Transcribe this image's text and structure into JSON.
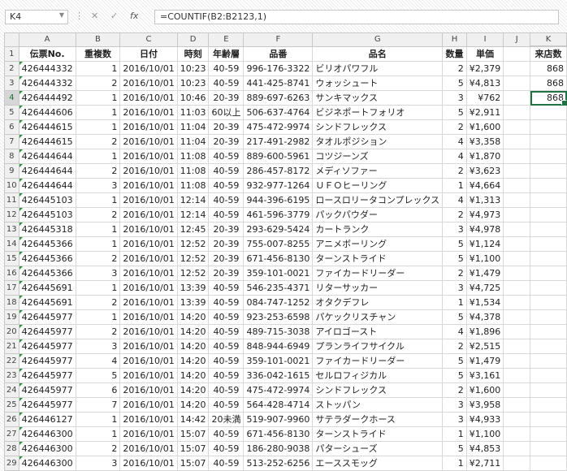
{
  "formula_bar": {
    "name_box": "K4",
    "cancel_icon": "✕",
    "enter_icon": "✓",
    "fx_label": "fx",
    "formula": "=COUNTIF(B2:B2123,1)"
  },
  "columns": [
    "A",
    "B",
    "C",
    "D",
    "E",
    "F",
    "G",
    "H",
    "I",
    "J",
    "K"
  ],
  "header_row": [
    "伝票No.",
    "重複数",
    "日付",
    "時刻",
    "年齢層",
    "品番",
    "品名",
    "数量",
    "単価",
    "",
    "来店数"
  ],
  "rows": [
    {
      "n": "2",
      "cells": [
        "426444332",
        "1",
        "2016/10/01",
        "10:23",
        "40-59",
        "996-176-3322",
        "ビリオパワフル",
        "2",
        "¥2,379",
        "",
        "868"
      ]
    },
    {
      "n": "3",
      "cells": [
        "426444332",
        "2",
        "2016/10/01",
        "10:23",
        "40-59",
        "441-425-8741",
        "ウォッシュート",
        "5",
        "¥4,813",
        "",
        "868"
      ]
    },
    {
      "n": "4",
      "cells": [
        "426444492",
        "1",
        "2016/10/01",
        "10:46",
        "20-39",
        "889-697-6263",
        "サンキマックス",
        "3",
        "¥762",
        "",
        "868"
      ]
    },
    {
      "n": "5",
      "cells": [
        "426444606",
        "1",
        "2016/10/01",
        "11:03",
        "60以上",
        "506-637-4764",
        "ビジネポートフォリオ",
        "5",
        "¥2,911",
        "",
        ""
      ]
    },
    {
      "n": "6",
      "cells": [
        "426444615",
        "1",
        "2016/10/01",
        "11:04",
        "20-39",
        "475-472-9974",
        "シンドフレックス",
        "2",
        "¥1,600",
        "",
        ""
      ]
    },
    {
      "n": "7",
      "cells": [
        "426444615",
        "2",
        "2016/10/01",
        "11:04",
        "20-39",
        "217-491-2982",
        "タオルポジション",
        "4",
        "¥3,358",
        "",
        ""
      ]
    },
    {
      "n": "8",
      "cells": [
        "426444644",
        "1",
        "2016/10/01",
        "11:08",
        "40-59",
        "889-600-5961",
        "コツジーンズ",
        "4",
        "¥1,870",
        "",
        ""
      ]
    },
    {
      "n": "9",
      "cells": [
        "426444644",
        "2",
        "2016/10/01",
        "11:08",
        "40-59",
        "286-457-8172",
        "メディソファー",
        "2",
        "¥3,623",
        "",
        ""
      ]
    },
    {
      "n": "10",
      "cells": [
        "426444644",
        "3",
        "2016/10/01",
        "11:08",
        "40-59",
        "932-977-1264",
        "ＵＦＯヒーリング",
        "1",
        "¥4,664",
        "",
        ""
      ]
    },
    {
      "n": "11",
      "cells": [
        "426445103",
        "1",
        "2016/10/01",
        "12:14",
        "40-59",
        "944-396-6195",
        "ロースロリータコンプレックス",
        "4",
        "¥1,313",
        "",
        ""
      ]
    },
    {
      "n": "12",
      "cells": [
        "426445103",
        "2",
        "2016/10/01",
        "12:14",
        "40-59",
        "461-596-3779",
        "パックパウダー",
        "2",
        "¥4,973",
        "",
        ""
      ]
    },
    {
      "n": "13",
      "cells": [
        "426445318",
        "1",
        "2016/10/01",
        "12:45",
        "20-39",
        "293-629-5424",
        "カートランク",
        "3",
        "¥4,978",
        "",
        ""
      ]
    },
    {
      "n": "14",
      "cells": [
        "426445366",
        "1",
        "2016/10/01",
        "12:52",
        "20-39",
        "755-007-8255",
        "アニメボーリング",
        "5",
        "¥1,124",
        "",
        ""
      ]
    },
    {
      "n": "15",
      "cells": [
        "426445366",
        "2",
        "2016/10/01",
        "12:52",
        "20-39",
        "671-456-8130",
        "ターンストライド",
        "5",
        "¥1,100",
        "",
        ""
      ]
    },
    {
      "n": "16",
      "cells": [
        "426445366",
        "3",
        "2016/10/01",
        "12:52",
        "20-39",
        "359-101-0021",
        "ファイカードリーダー",
        "2",
        "¥1,479",
        "",
        ""
      ]
    },
    {
      "n": "17",
      "cells": [
        "426445691",
        "1",
        "2016/10/01",
        "13:39",
        "40-59",
        "546-235-4371",
        "リターサッカー",
        "3",
        "¥4,725",
        "",
        ""
      ]
    },
    {
      "n": "18",
      "cells": [
        "426445691",
        "2",
        "2016/10/01",
        "13:39",
        "40-59",
        "084-747-1252",
        "オタクデフレ",
        "1",
        "¥1,534",
        "",
        ""
      ]
    },
    {
      "n": "19",
      "cells": [
        "426445977",
        "1",
        "2016/10/01",
        "14:20",
        "40-59",
        "923-253-6598",
        "パケックリスチャン",
        "5",
        "¥4,378",
        "",
        ""
      ]
    },
    {
      "n": "20",
      "cells": [
        "426445977",
        "2",
        "2016/10/01",
        "14:20",
        "40-59",
        "489-715-3038",
        "アイロゴースト",
        "4",
        "¥1,896",
        "",
        ""
      ]
    },
    {
      "n": "21",
      "cells": [
        "426445977",
        "3",
        "2016/10/01",
        "14:20",
        "40-59",
        "848-944-6949",
        "プランライフサイクル",
        "2",
        "¥2,515",
        "",
        ""
      ]
    },
    {
      "n": "22",
      "cells": [
        "426445977",
        "4",
        "2016/10/01",
        "14:20",
        "40-59",
        "359-101-0021",
        "ファイカードリーダー",
        "5",
        "¥1,479",
        "",
        ""
      ]
    },
    {
      "n": "23",
      "cells": [
        "426445977",
        "5",
        "2016/10/01",
        "14:20",
        "40-59",
        "336-042-1615",
        "セルロフィジカル",
        "5",
        "¥3,161",
        "",
        ""
      ]
    },
    {
      "n": "24",
      "cells": [
        "426445977",
        "6",
        "2016/10/01",
        "14:20",
        "40-59",
        "475-472-9974",
        "シンドフレックス",
        "2",
        "¥1,600",
        "",
        ""
      ]
    },
    {
      "n": "25",
      "cells": [
        "426445977",
        "7",
        "2016/10/01",
        "14:20",
        "40-59",
        "564-428-4714",
        "ストッパン",
        "3",
        "¥3,958",
        "",
        ""
      ]
    },
    {
      "n": "26",
      "cells": [
        "426446127",
        "1",
        "2016/10/01",
        "14:42",
        "20未満",
        "519-907-9960",
        "サテラダークホース",
        "3",
        "¥4,933",
        "",
        ""
      ]
    },
    {
      "n": "27",
      "cells": [
        "426446300",
        "1",
        "2016/10/01",
        "15:07",
        "40-59",
        "671-456-8130",
        "ターンストライド",
        "1",
        "¥1,100",
        "",
        ""
      ]
    },
    {
      "n": "28",
      "cells": [
        "426446300",
        "2",
        "2016/10/01",
        "15:07",
        "40-59",
        "186-280-9038",
        "パターシューズ",
        "5",
        "¥4,853",
        "",
        ""
      ]
    },
    {
      "n": "29",
      "cells": [
        "426446300",
        "3",
        "2016/10/01",
        "15:07",
        "40-59",
        "513-252-6256",
        "エーススモッグ",
        "1",
        "¥2,711",
        "",
        ""
      ]
    }
  ],
  "selection": {
    "row": "4",
    "col": "K"
  }
}
